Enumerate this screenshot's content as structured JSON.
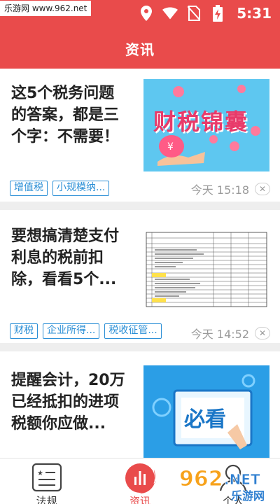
{
  "status_bar": {
    "watermark": "乐游网 www.962.net",
    "time": "5:31"
  },
  "header": {
    "title": "资讯"
  },
  "articles": [
    {
      "title": "这5个税务问题的答案，都是三个字：不需要！",
      "title_lines": [
        "这5个税务问题",
        "的答案，都是三",
        "个字：不需要！"
      ],
      "thumb_text": "财税锦囊",
      "tags": [
        "增值税",
        "小规模纳..."
      ],
      "time": "今天 15:18"
    },
    {
      "title": "要想搞清楚支付利息的税前扣除，看看5个...",
      "title_lines": [
        "要想搞清楚支付",
        "利息的税前扣",
        "除，看看5个..."
      ],
      "thumb_text": "",
      "tags": [
        "财税",
        "企业所得...",
        "税收征管..."
      ],
      "time": "今天 14:52"
    },
    {
      "title": "提醒会计，20万已经抵扣的进项税额你应做...",
      "title_lines": [
        "提醒会计，20万",
        "已经抵扣的进项",
        "税额你应做..."
      ],
      "thumb_text": "必看",
      "tags": [],
      "time": ""
    }
  ],
  "bottom_nav": {
    "items": [
      {
        "label": "法规",
        "icon": "document-icon",
        "active": false
      },
      {
        "label": "资讯",
        "icon": "chart-bars-icon",
        "active": true
      },
      {
        "label": "个人",
        "icon": "user-icon",
        "active": false
      }
    ]
  },
  "overlay_logo": {
    "text": "962.NET",
    "subtext": "乐游网"
  },
  "colors": {
    "brand_red": "#e94b4b",
    "tag_blue": "#2b8fd6"
  }
}
